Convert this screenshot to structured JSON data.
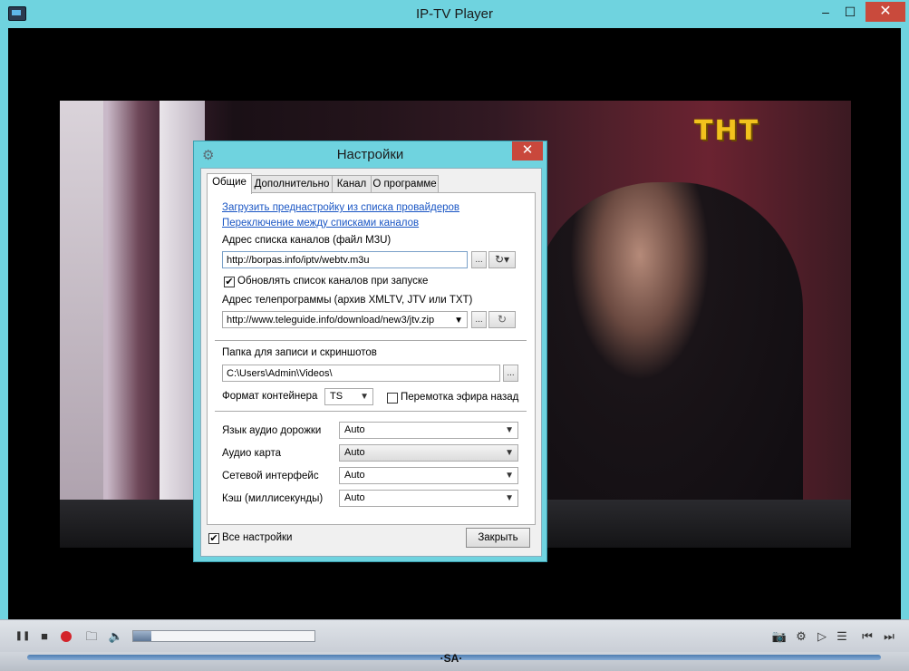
{
  "window": {
    "title": "IP-TV Player",
    "minimize_glyph": "–",
    "maximize_glyph": "☐",
    "close_glyph": "✕"
  },
  "video": {
    "channel_logo": "ТНТ"
  },
  "dialog": {
    "title": "Настройки",
    "close_glyph": "✕",
    "tabs": [
      {
        "label": "Общие",
        "active": true
      },
      {
        "label": "Дополнительно",
        "active": false
      },
      {
        "label": "Канал",
        "active": false
      },
      {
        "label": "О программе",
        "active": false
      }
    ],
    "general": {
      "link_preset": "Загрузить преднастройку из списка провайдеров",
      "link_switch": "Переключение между списками каналов",
      "playlist_label": "Адрес списка каналов (файл M3U)",
      "playlist_value": "http://borpas.info/iptv/webtv.m3u",
      "browse_label": "...",
      "refresh_glyph": "↻▾",
      "update_on_start_label": "Обновлять список каналов при запуске",
      "update_on_start_checked": true,
      "epg_label": "Адрес телепрограммы (архив XMLTV, JTV или TXT)",
      "epg_value": "http://www.teleguide.info/download/new3/jtv.zip",
      "epg_refresh_glyph": "↻",
      "folder_label": "Папка для записи и скриншотов",
      "folder_value": "C:\\Users\\Admin\\Videos\\",
      "container_label": "Формат контейнера",
      "container_value": "TS",
      "timeshift_label": "Перемотка эфира назад",
      "timeshift_checked": false,
      "audio_track_label": "Язык аудио дорожки",
      "audio_track_value": "Auto",
      "audio_card_label": "Аудио карта",
      "audio_card_value": "Auto",
      "network_label": "Сетевой интерфейс",
      "network_value": "Auto",
      "cache_label": "Кэш (миллисекунды)",
      "cache_value": "Auto"
    },
    "all_settings_label": "Все настройки",
    "all_settings_checked": true,
    "close_button": "Закрыть"
  },
  "controls": {
    "pause_glyph": "❚❚",
    "stop_glyph": "■",
    "open_glyph": "🗀",
    "volume_glyph": "🔈",
    "volume_level": 0.1,
    "snapshot_glyph": "📷",
    "settings_glyph": "⚙",
    "play_glyph": "▷",
    "list_glyph": "☰",
    "prev_glyph": "⏮",
    "next_glyph": "⏭",
    "position_handle": "·SA·"
  }
}
